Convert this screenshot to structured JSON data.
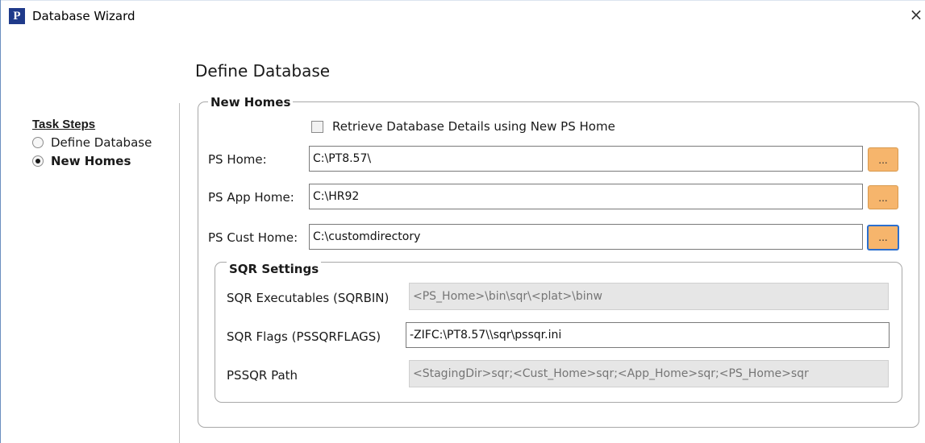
{
  "window": {
    "title": "Database Wizard",
    "app_icon_letter": "P",
    "close_glyph": "×"
  },
  "page": {
    "title": "Define Database"
  },
  "task_steps": {
    "heading": "Task Steps",
    "items": [
      {
        "label": "Define Database",
        "selected": false
      },
      {
        "label": "New Homes",
        "selected": true
      }
    ]
  },
  "new_homes": {
    "legend": "New Homes",
    "retrieve_checkbox": {
      "label": "Retrieve Database Details using New PS Home",
      "checked": false
    },
    "ps_home": {
      "label": "PS Home:",
      "value": "C:\\PT8.57\\",
      "browse_label": "..."
    },
    "ps_app_home": {
      "label": "PS App Home:",
      "value": "C:\\HR92",
      "browse_label": "..."
    },
    "ps_cust_home": {
      "label": "PS Cust Home:",
      "value": "C:\\customdirectory",
      "browse_label": "..."
    }
  },
  "sqr_settings": {
    "legend": "SQR Settings",
    "executables": {
      "label": "SQR Executables (SQRBIN)",
      "placeholder": "<PS_Home>\\bin\\sqr\\<plat>\\binw",
      "value": "",
      "disabled": true
    },
    "flags": {
      "label": "SQR Flags (PSSQRFLAGS)",
      "value": "-ZIFC:\\PT8.57\\\\sqr\\pssqr.ini",
      "disabled": false
    },
    "path": {
      "label": "PSSQR Path",
      "placeholder": "<StagingDir>sqr;<Cust_Home>sqr;<App_Home>sqr;<PS_Home>sqr",
      "value": "",
      "disabled": true
    }
  },
  "colors": {
    "browse_button": "#f6b56c",
    "focus_border": "#2b6fce",
    "disabled_field": "#e6e6e6",
    "window_border": "#6b8fbf"
  },
  "icons": {
    "app": "pshome-p-icon",
    "close": "close-icon",
    "radio_selected": "radio-selected-icon",
    "radio_unselected": "radio-unselected-icon"
  }
}
